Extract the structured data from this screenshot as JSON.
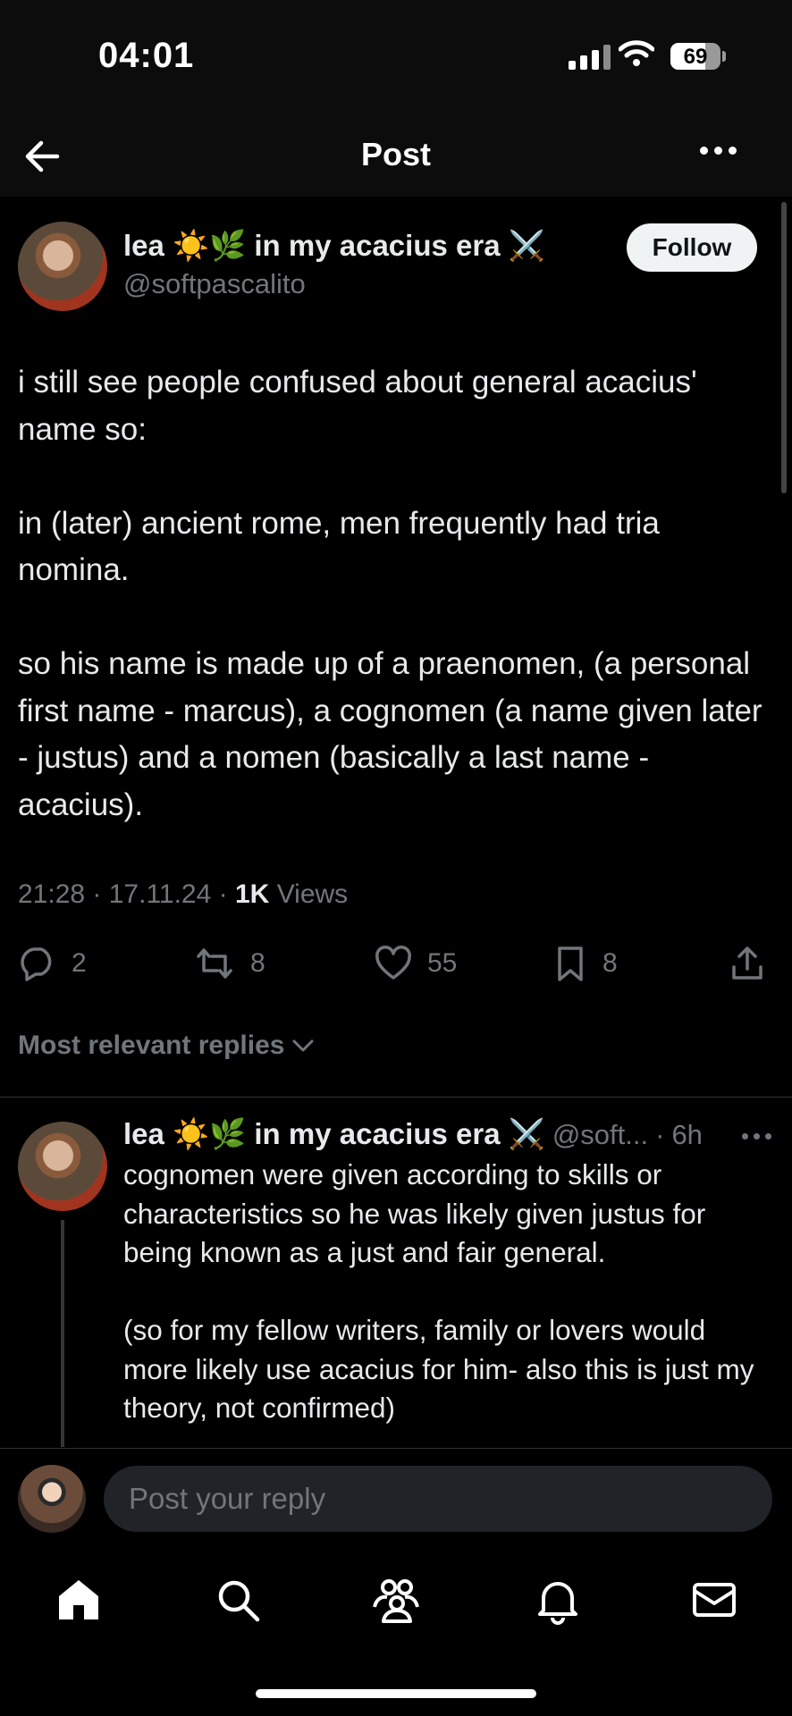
{
  "status_bar": {
    "time": "04:01",
    "battery_percent": "69",
    "battery_level": 0.69,
    "signal_bars": 4,
    "wifi": "wifi-icon"
  },
  "header": {
    "title": "Post",
    "back_icon": "arrow-left-icon",
    "more_icon": "more-horizontal-icon"
  },
  "post": {
    "author": {
      "display_name": "lea ☀️🌿 in my acacius era ⚔️",
      "handle": "@softpascalito"
    },
    "follow_label": "Follow",
    "text": [
      "i still see people confused about general acacius' name so:",
      "in (later) ancient rome, men frequently had tria nomina.",
      "so his name is made up of a praenomen, (a personal first name - marcus), a cognomen (a name given later - justus) and a nomen (basically a last name - acacius)."
    ],
    "time": "21:28",
    "date": "17.11.24",
    "views_count": "1K",
    "views_label": "Views",
    "stats": {
      "replies": "2",
      "reposts": "8",
      "likes": "55",
      "bookmarks": "8"
    }
  },
  "replies_filter": {
    "label": "Most relevant replies",
    "icon": "chevron-down-icon"
  },
  "reply": {
    "display_name": "lea ☀️🌿 in my acacius era ⚔️",
    "handle": "@soft...",
    "age": "6h",
    "text": [
      "cognomen were given according to skills or characteristics so he was likely given justus for being known as a just and fair general.",
      "(so for my fellow writers, family or lovers would more likely use acacius for him- also this is just my theory, not confirmed)"
    ]
  },
  "composer": {
    "placeholder": "Post your reply"
  },
  "tabs": [
    {
      "name": "home",
      "icon": "home-icon",
      "active": true
    },
    {
      "name": "search",
      "icon": "search-icon"
    },
    {
      "name": "communities",
      "icon": "communities-icon"
    },
    {
      "name": "notifications",
      "icon": "bell-icon"
    },
    {
      "name": "messages",
      "icon": "mail-icon"
    }
  ],
  "colors": {
    "background": "#000000",
    "text": "#e7e9ea",
    "secondary": "#71767b",
    "divider": "#2f3336"
  }
}
